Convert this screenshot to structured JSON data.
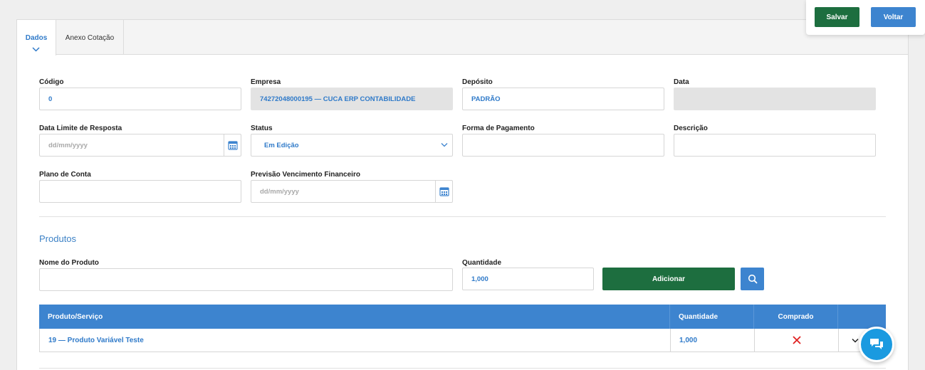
{
  "tabs": [
    {
      "label": "Dados",
      "active": true
    },
    {
      "label": "Anexo Cotação",
      "active": false
    }
  ],
  "toolbar": {
    "save_label": "Salvar",
    "back_label": "Voltar"
  },
  "form": {
    "codigo": {
      "label": "Código",
      "value": "0"
    },
    "empresa": {
      "label": "Empresa",
      "value": "74272048000195 — CUCA ERP CONTABILIDADE"
    },
    "deposito": {
      "label": "Depósito",
      "value": "PADRÃO"
    },
    "data": {
      "label": "Data",
      "value": ""
    },
    "data_limite": {
      "label": "Data Limite de Resposta",
      "placeholder": "dd/mm/yyyy"
    },
    "status": {
      "label": "Status",
      "value": "Em Edição"
    },
    "forma_pagamento": {
      "label": "Forma de Pagamento",
      "value": ""
    },
    "descricao": {
      "label": "Descrição",
      "value": ""
    },
    "plano_conta": {
      "label": "Plano de Conta",
      "value": ""
    },
    "previsao": {
      "label": "Previsão Vencimento Financeiro",
      "placeholder": "dd/mm/yyyy"
    }
  },
  "produtos": {
    "title": "Produtos",
    "nome_label": "Nome do Produto",
    "nome_value": "",
    "quantidade_label": "Quantidade",
    "quantidade_value": "1,000",
    "add_label": "Adicionar",
    "search_icon": "search-icon"
  },
  "table": {
    "headers": [
      "Produto/Serviço",
      "Quantidade",
      "Comprado",
      ""
    ],
    "rows": [
      {
        "produto": "19 — Produto Variável Teste",
        "quantidade": "1,000",
        "comprado_icon": "close-icon"
      }
    ]
  },
  "colors": {
    "green": "#1d6e3f",
    "blue": "#3d84cf",
    "text_blue": "#2f7ac9",
    "red": "#e02020",
    "chat": "#1a9ae0"
  }
}
